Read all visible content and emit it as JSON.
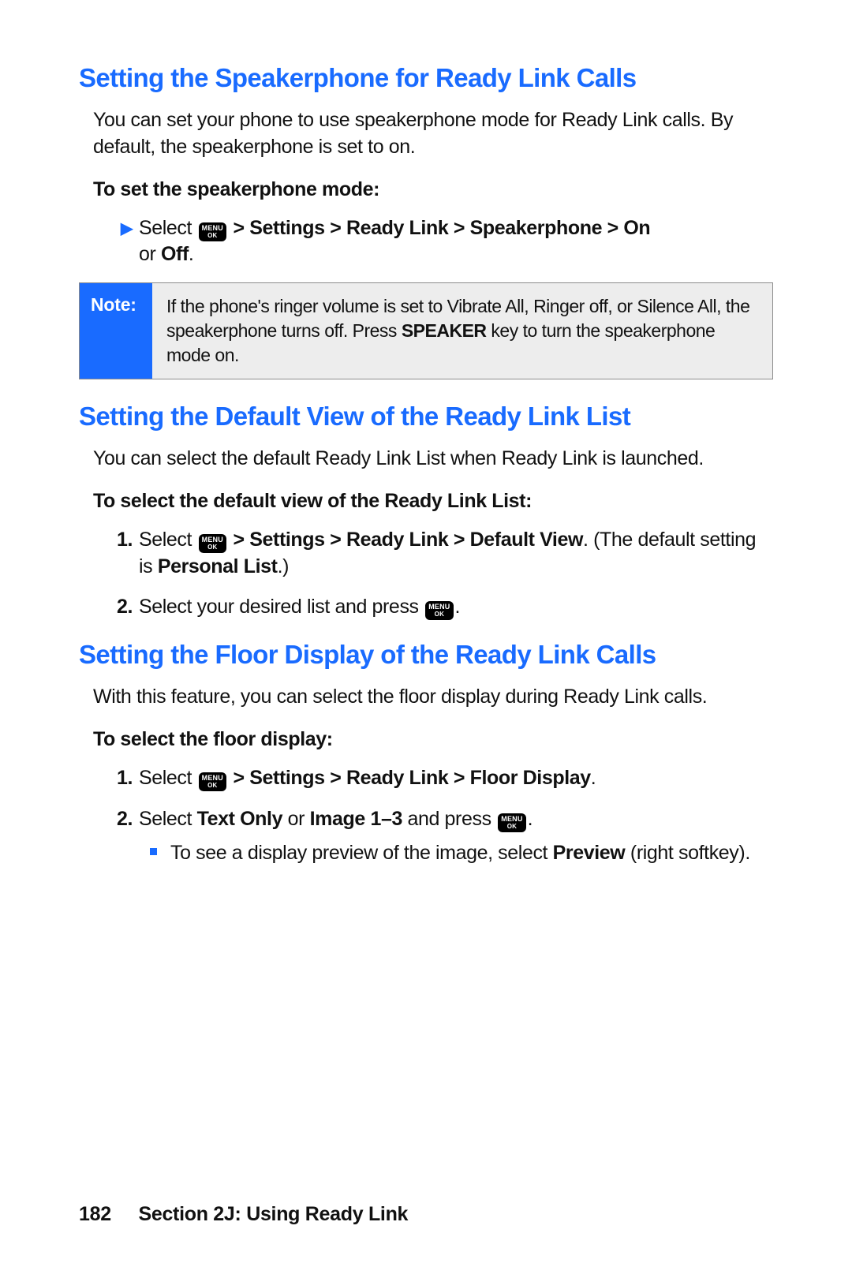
{
  "menu_ok_icon": {
    "line1": "MENU",
    "line2": "OK"
  },
  "section1": {
    "title": "Setting the Speakerphone for Ready Link Calls",
    "intro": "You can set your phone to use speakerphone mode for Ready Link calls. By default, the speakerphone is set to on.",
    "subhead": "To set the speakerphone mode:",
    "step1_pre": "Select ",
    "step1_path": " > Settings > Ready Link > Speakerphone > On",
    "step1_post_or": "or ",
    "step1_off": "Off",
    "step1_period": "."
  },
  "note": {
    "label": "Note:",
    "text_pre": "If the phone's ringer volume is set to Vibrate All, Ringer off, or Silence All, the speakerphone turns off. Press ",
    "speaker": "SPEAKER",
    "text_post": " key to turn the speakerphone mode on."
  },
  "section2": {
    "title": "Setting the Default View of the Ready Link List",
    "intro": "You can select the default Ready Link List when Ready Link is launched.",
    "subhead": "To select the default view of the Ready Link List:",
    "step1_pre": "Select ",
    "step1_path": " > Settings > Ready Link > Default View",
    "step1_after": ". (The default setting is ",
    "step1_personal": "Personal List",
    "step1_close": ".)",
    "step2_pre": "Select your desired list and press ",
    "step2_post": "."
  },
  "section3": {
    "title": "Setting the Floor Display of the Ready Link Calls",
    "intro": "With this feature, you can select the floor display during Ready Link calls.",
    "subhead": "To select the floor display:",
    "step1_pre": "Select ",
    "step1_path": " > Settings > Ready Link > Floor Display",
    "step1_post": ".",
    "step2_pre": "Select ",
    "step2_text_only": "Text Only",
    "step2_or": " or ",
    "step2_image": "Image 1–3",
    "step2_and": " and press ",
    "step2_post": ".",
    "sub_pre": "To see a display preview of the image, select ",
    "sub_preview": "Preview",
    "sub_post": " (right softkey)."
  },
  "footer": {
    "page": "182",
    "label": "Section 2J: Using Ready Link"
  }
}
